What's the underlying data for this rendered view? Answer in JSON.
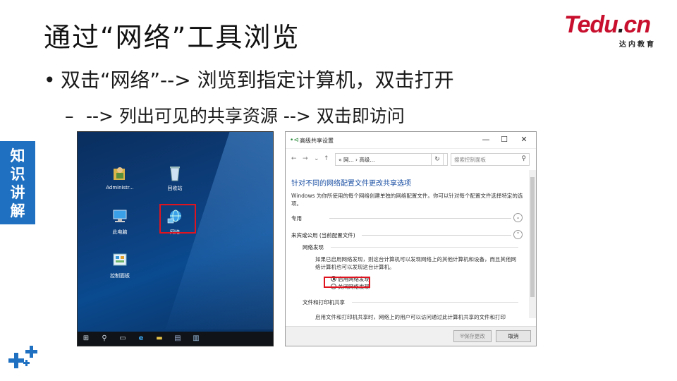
{
  "slide": {
    "title": "通过“网络”工具浏览",
    "bullet1": "双击“网络”--> 浏览到指定计算机，双击打开",
    "bullet2": "--> 列出可见的共享资源 --> 双击即访问",
    "bullet1_marker": "•",
    "bullet2_marker": "–"
  },
  "logo": {
    "main": "Tedu",
    "dot": ".",
    "suffix": "cn",
    "sub": "达内教育",
    "color": "#c8102e"
  },
  "side_tab": {
    "chars": [
      "知",
      "识",
      "讲",
      "解"
    ],
    "color": "#1f70c1"
  },
  "desktop": {
    "icons": [
      {
        "label": "Administr...",
        "icon": "user-folder-icon"
      },
      {
        "label": "回收站",
        "icon": "recycle-bin-icon"
      },
      {
        "label": "此电脑",
        "icon": "computer-icon"
      },
      {
        "label": "网络",
        "icon": "network-icon"
      },
      {
        "label": "控制面板",
        "icon": "control-panel-icon"
      }
    ],
    "taskbar": [
      "start-icon",
      "search-icon",
      "task-view-icon",
      "edge-icon",
      "explorer-icon",
      "server-manager-icon",
      "file-icon"
    ]
  },
  "window": {
    "title": "高级共享设置",
    "controls": {
      "minimize": "—",
      "maximize": "☐",
      "close": "✕"
    },
    "address": "« 网... › 高级...",
    "search_placeholder": "搜索控制面板",
    "heading": "针对不同的网络配置文件更改共享选项",
    "description": "Windows 为你所使用的每个网络创建单独的网络配置文件。你可以针对每个配置文件选择特定的选项。",
    "sections": {
      "private": "专用",
      "guest_public": "来宾或公用 (当前配置文件)",
      "network_discovery": "网络发现",
      "discovery_text": "如果已启用网络发现，则这台计算机可以发现网络上的其他计算机和设备，而且其他网络计算机也可以发现这台计算机。",
      "radio_on": "启用网络发现",
      "radio_off": "关闭网络发现",
      "file_printer": "文件和打印机共享",
      "file_printer_text": "启用文件和打印机共享时，网络上的用户可以访问通过此计算机共享的文件和打印"
    },
    "buttons": {
      "save": "保存更改",
      "cancel": "取消"
    }
  }
}
